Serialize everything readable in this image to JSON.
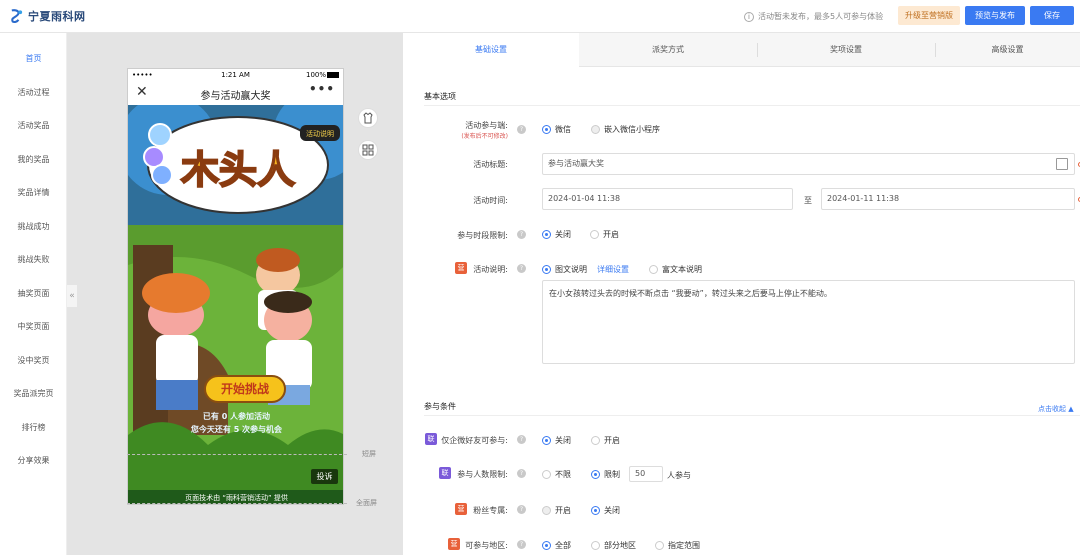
{
  "header": {
    "logo_text": "宁夏雨科网",
    "notice": "活动暂未发布，最多5人可参与体验",
    "upgrade_label": "升级至营销版",
    "preview_label": "预览与发布",
    "save_label": "保存"
  },
  "sidebar": {
    "collapse_glyph": "«",
    "items": [
      {
        "label": "首页",
        "active": true
      },
      {
        "label": "活动过程"
      },
      {
        "label": "活动奖品"
      },
      {
        "label": "我的奖品"
      },
      {
        "label": "奖品详情"
      },
      {
        "label": "挑战成功"
      },
      {
        "label": "挑战失败"
      },
      {
        "label": "抽奖页面"
      },
      {
        "label": "中奖页面"
      },
      {
        "label": "没中奖页"
      },
      {
        "label": "奖品派完页"
      },
      {
        "label": "排行榜"
      },
      {
        "label": "分享效果"
      }
    ]
  },
  "phone": {
    "status_left": "•••••",
    "status_time": "1:21 AM",
    "status_battery": "100%",
    "nav_close": "✕",
    "nav_title": "参与活动赢大奖",
    "nav_more": "•••",
    "poster_title": "木头人",
    "poster_badge": "活动说明",
    "cta_label": "开始挑战",
    "participants_line": "已有 0 人参加活动",
    "chances_line": "您今天还有 5 次参与机会",
    "complain_label": "投诉",
    "footer_credit": "页面技术由 “雨科营销活动” 提供",
    "guide_short": "短屏",
    "guide_full": "全面屏"
  },
  "tabs": [
    {
      "label": "基础设置",
      "active": true
    },
    {
      "label": "派奖方式"
    },
    {
      "label": "奖项设置"
    },
    {
      "label": "高级设置"
    }
  ],
  "basic": {
    "section_title": "基本选项",
    "participant_label": "活动参与端:",
    "participant_sub": "(发布后不可修改)",
    "opt_wechat": "微信",
    "opt_miniprogram": "嵌入微信小程序",
    "title_label": "活动标题:",
    "title_value": "参与活动赢大奖",
    "time_label": "活动时间:",
    "time_start": "2024-01-04 11:38",
    "time_sep": "至",
    "time_end": "2024-01-11 11:38",
    "period_label": "参与时段限制:",
    "opt_off": "关闭",
    "opt_on": "开启",
    "desc_label": "活动说明:",
    "opt_graphic": "图文说明",
    "detail_link": "详细设置",
    "opt_richtext": "富文本说明",
    "desc_text": "在小女孩转过头去的时候不断点击 “我要动”，转过头来之后要马上停止不能动。"
  },
  "conditions": {
    "section_title": "参与条件",
    "collapse_link": "点击收起 ▲",
    "friends_label": "仅企微好友可参与:",
    "limit_label": "参与人数限制:",
    "opt_unlimited": "不限",
    "opt_limit": "限制",
    "limit_value": "50",
    "limit_unit": "人参与",
    "fans_label": "粉丝专属:",
    "region_label": "可参与地区:",
    "opt_all": "全部",
    "opt_partial": "部分地区",
    "opt_range": "指定范围",
    "badge_lian": "联",
    "badge_ying": "营"
  },
  "colors": {
    "accent": "#3a7af2",
    "upgrade_bg": "#fde9d2",
    "upgrade_fg": "#c07020",
    "badge_purple": "#7a5ad9",
    "badge_orange": "#e8613a"
  }
}
